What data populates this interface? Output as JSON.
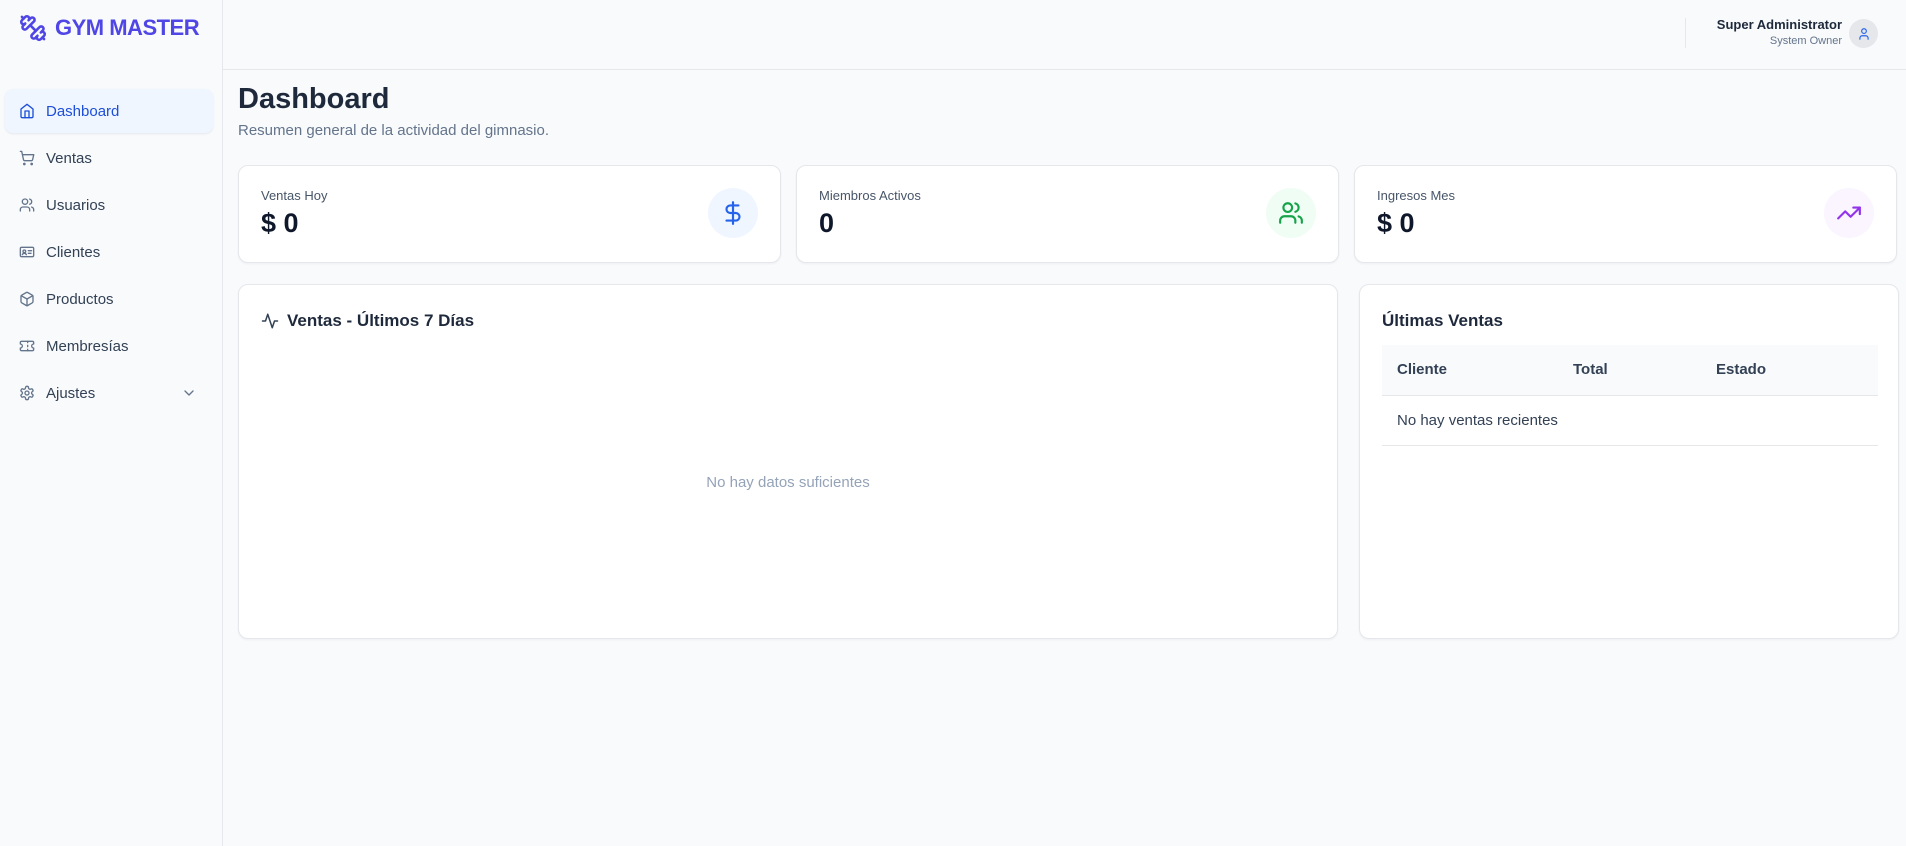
{
  "brand": {
    "name": "GYM MASTER",
    "icon": "dumbbell-icon",
    "color": "#4f46e5"
  },
  "sidebar": {
    "items": [
      {
        "label": "Dashboard",
        "icon": "home-icon",
        "active": true
      },
      {
        "label": "Ventas",
        "icon": "shopping-cart-icon"
      },
      {
        "label": "Usuarios",
        "icon": "users-icon"
      },
      {
        "label": "Clientes",
        "icon": "id-card-icon"
      },
      {
        "label": "Productos",
        "icon": "box-icon"
      },
      {
        "label": "Membresías",
        "icon": "ticket-icon"
      },
      {
        "label": "Ajustes",
        "icon": "gear-icon",
        "expandable": true
      }
    ]
  },
  "header": {
    "user_name": "Super Administrator",
    "user_role": "System Owner",
    "avatar_icon": "user-icon"
  },
  "page": {
    "title": "Dashboard",
    "subtitle": "Resumen general de la actividad del gimnasio."
  },
  "stats": [
    {
      "label": "Ventas Hoy",
      "value": "$ 0",
      "icon": "dollar-icon",
      "color": "#2563eb",
      "bg": "#eff6ff"
    },
    {
      "label": "Miembros Activos",
      "value": "0",
      "icon": "users-icon",
      "color": "#16a34a",
      "bg": "#f0fdf4"
    },
    {
      "label": "Ingresos Mes",
      "value": "$ 0",
      "icon": "trending-up-icon",
      "color": "#9333ea",
      "bg": "#faf5ff"
    }
  ],
  "sales_chart": {
    "title": "Ventas - Últimos 7 Días",
    "icon": "activity-icon",
    "empty_message": "No hay datos suficientes"
  },
  "recent_sales": {
    "title": "Últimas Ventas",
    "columns": [
      "Cliente",
      "Total",
      "Estado"
    ],
    "empty_message": "No hay ventas recientes"
  }
}
